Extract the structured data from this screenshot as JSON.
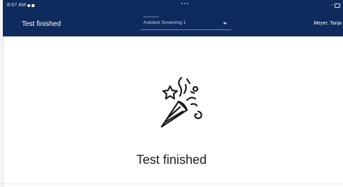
{
  "status_bar": {
    "time": "8:07 AM"
  },
  "header": {
    "page_title": "Test finished",
    "selector": {
      "label": "Assessment",
      "value": "Autotest Screening 1"
    },
    "user_name": "Meyer, Tanja"
  },
  "main": {
    "icon": "party-popper-icon",
    "message": "Test finished"
  },
  "colors": {
    "header_bg": "#0f2a5c",
    "page_bg": "#ffffff",
    "text": "#1b1b1b"
  }
}
